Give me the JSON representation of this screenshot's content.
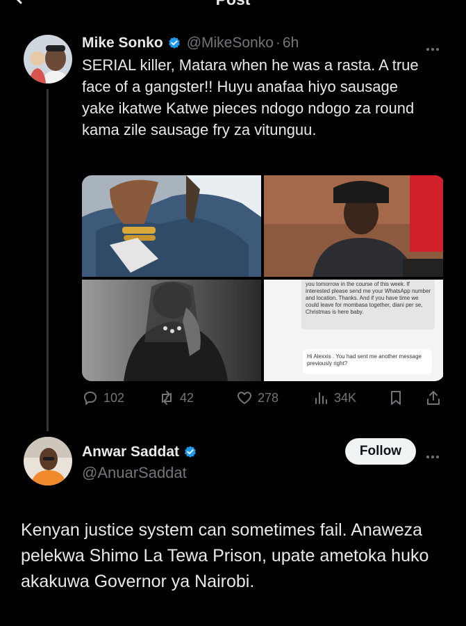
{
  "header": {
    "title": "Post"
  },
  "tweet1": {
    "name": "Mike Sonko",
    "handle": "@MikeSonko",
    "dot": "·",
    "time": "6h",
    "text": "SERIAL killer, Matara when he was a rasta. A true face of a gangster!! Huyu anafaa hiyo sausage yake ikatwe Katwe pieces ndogo ndogo za round kama zile sausage  fry za vitunguu.",
    "media": {
      "dm_messages": [
        "you tomorrow in the course of this week. If interested please send me your WhatsApp number and location.  Thanks.  And if you have time we could leave for mombasa together, diani per se, Christmas is here baby.",
        "Hi Alexxis . You had sent me another message previously right?"
      ]
    },
    "actions": {
      "replies": "102",
      "reposts": "42",
      "likes": "278",
      "views": "34K"
    }
  },
  "tweet2": {
    "name": "Anwar Saddat",
    "handle": "@AnuarSaddat",
    "follow_label": "Follow",
    "text": "Kenyan justice system can sometimes fail. Anaweza pelekwa Shimo La Tewa Prison, upate ametoka huko akakuwa Governor ya Nairobi."
  },
  "colors": {
    "background": "#000000",
    "text": "#e7e9ea",
    "secondary": "#71767b",
    "verified": "#1d9bf0",
    "follow_bg": "#eff3f4"
  }
}
